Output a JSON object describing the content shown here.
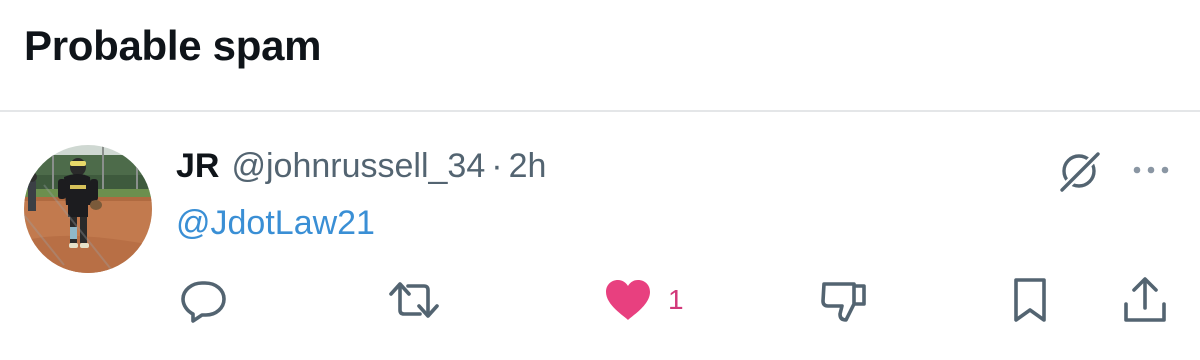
{
  "section": {
    "title": "Probable spam"
  },
  "tweet": {
    "author_name": "JR",
    "author_handle": "@johnrussell_34",
    "separator": "·",
    "timestamp": "2h",
    "text": "@JdotLaw21",
    "avatar_icon": "baseball-player-avatar",
    "actions": {
      "reply_icon": "reply-icon",
      "retweet_icon": "retweet-icon",
      "like_icon": "heart-filled-icon",
      "like_count": "1",
      "dislike_icon": "thumbs-down-icon",
      "bookmark_icon": "bookmark-icon",
      "share_icon": "share-icon"
    },
    "top_icons": [
      "grok-icon",
      "more-dots-icon"
    ]
  },
  "colors": {
    "text_primary": "#0f1419",
    "text_secondary": "#536471",
    "mention": "#3a8fd5",
    "like": "#e8407f",
    "divider": "#e4e6e8"
  }
}
